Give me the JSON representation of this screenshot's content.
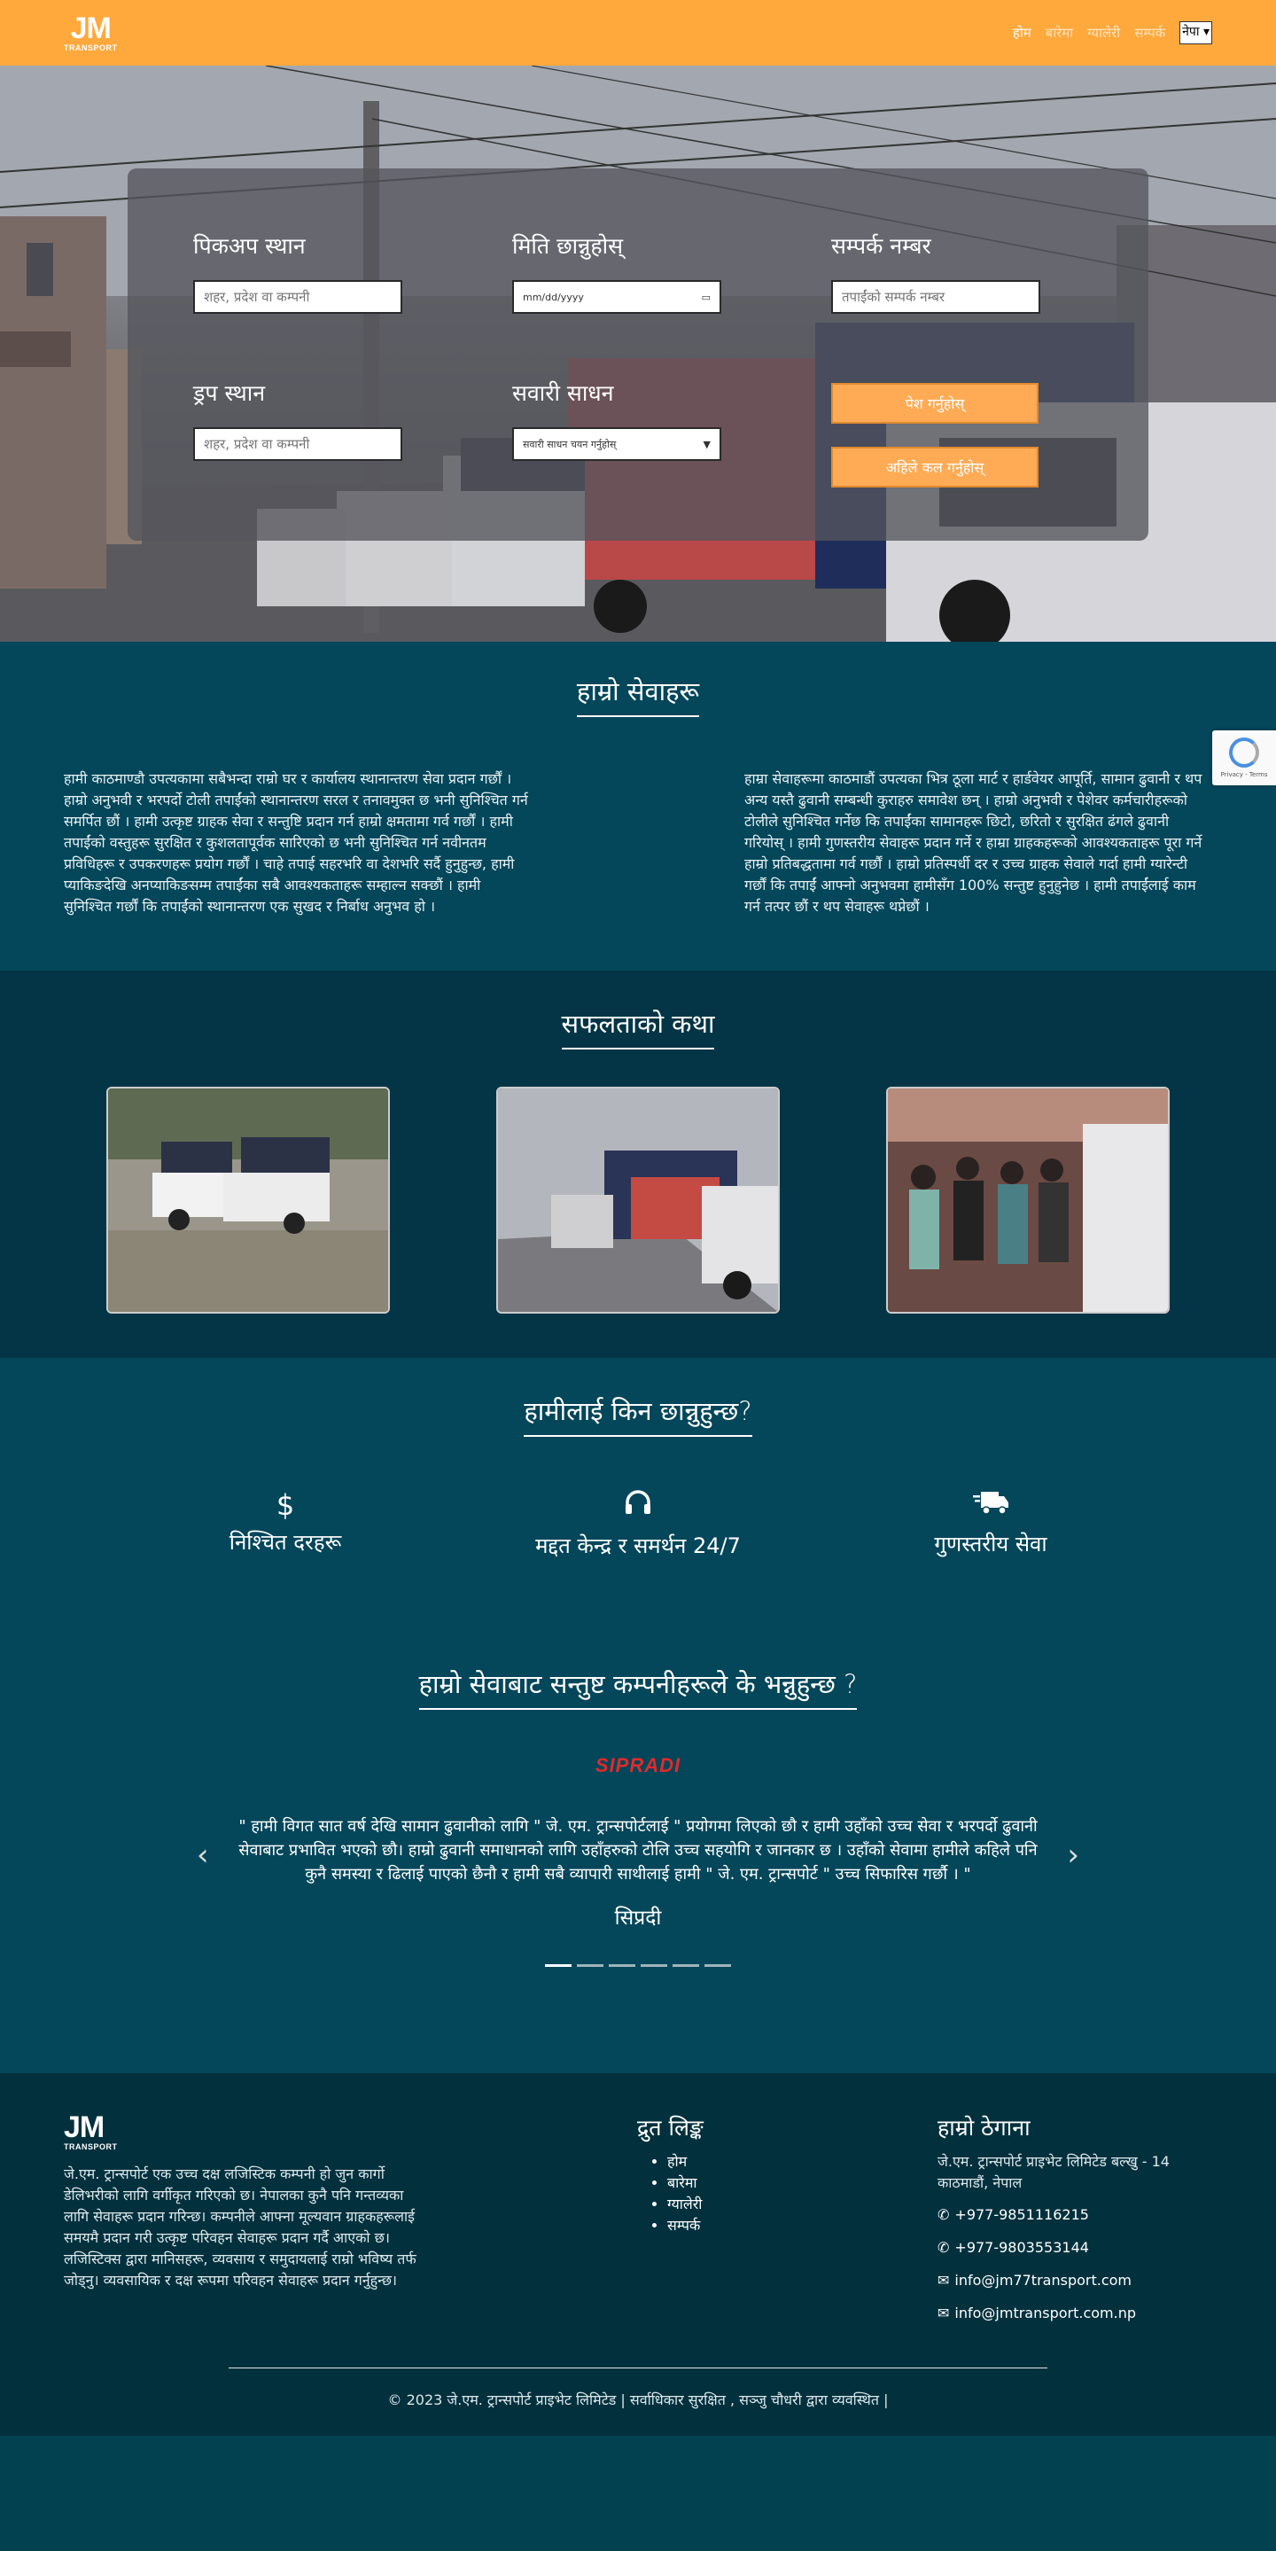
{
  "header": {
    "logo_mark": "JM",
    "logo_sub": "TRANSPORT",
    "nav": [
      "होम",
      "बारेमा",
      "ग्यालेरी",
      "सम्पर्क"
    ],
    "language": "नेपा"
  },
  "booking": {
    "pickup_label": "पिकअप स्थान",
    "pickup_placeholder": "शहर, प्रदेश वा कम्पनी",
    "date_label": "मिति छान्नुहोस्",
    "date_placeholder": "mm/dd/yyyy",
    "contact_label": "सम्पर्क नम्बर",
    "contact_placeholder": "तपाईंको सम्पर्क नम्बर",
    "drop_label": "ड्रप स्थान",
    "drop_placeholder": "शहर, प्रदेश वा कम्पनी",
    "vehicle_label": "सवारी साधन",
    "vehicle_value": "सवारी साधन चयन गर्नुहोस्",
    "submit_label": "पेश गर्नुहोस्",
    "call_label": "अहिले कल गर्नुहोस्"
  },
  "services": {
    "title": "हाम्रो सेवाहरू",
    "col1": "हामी काठमाण्डौ उपत्यकामा सबैभन्दा राम्रो घर र कार्यालय स्थानान्तरण सेवा प्रदान गर्छौं । हाम्रो अनुभवी र भरपर्दो टोली तपाईंको स्थानान्तरण सरल र तनावमुक्त छ भनी सुनिश्चित गर्न समर्पित छौं । हामी उत्कृष्ट ग्राहक सेवा र सन्तुष्टि प्रदान गर्न हाम्रो क्षमतामा गर्व गर्छौं । हामी तपाईंको वस्तुहरू सुरक्षित र कुशलतापूर्वक सारिएको छ भनी सुनिश्चित गर्न नवीनतम प्रविधिहरू र उपकरणहरू प्रयोग गर्छौं । चाहे तपाई सहरभरि वा देशभरि सर्दै हुनुहुन्छ, हामी प्याकिङदेखि अनप्याकिङसम्म तपाईंका सबै आवश्यकताहरू सम्हाल्न सक्छौं । हामी सुनिश्चित गर्छौं कि तपाईंको स्थानान्तरण एक सुखद र निर्बाध अनुभव हो ।",
    "col2": "हाम्रा सेवाहरूमा काठमाडौं उपत्यका भित्र ठूला मार्ट र हार्डवेयर आपूर्ति, सामान ढुवानी र थप अन्य यस्तै ढुवानी सम्बन्धी कुराहरु समावेश छन् । हाम्रो अनुभवी र पेशेवर कर्मचारीहरूको टोलीले सुनिश्चित गर्नेछ कि तपाईंका सामानहरू छिटो, छरितो र सुरक्षित ढंगले ढुवानी गरियोस् । हामी गुणस्तरीय सेवाहरू प्रदान गर्ने र हाम्रा ग्राहकहरूको आवश्यकताहरू पूरा गर्ने हाम्रो प्रतिबद्धतामा गर्व गर्छौं । हाम्रो प्रतिस्पर्धी दर र उच्च ग्राहक सेवाले गर्दा हामी ग्यारेन्टी गर्छौं कि तपाईं आफ्नो अनुभवमा हामीसँग 100% सन्तुष्ट हुनुहुनेछ । हामी तपाईंलाई काम गर्न तत्पर छौं र थप सेवाहरू थप्नेछौं ।"
  },
  "stories": {
    "title": "सफलताको कथा"
  },
  "why": {
    "title": "हामीलाई किन छान्नुहुन्छ?",
    "features": [
      {
        "icon": "dollar-icon",
        "label": "निश्चित दरहरू"
      },
      {
        "icon": "headset-icon",
        "label": "मद्दत केन्द्र र समर्थन 24/7"
      },
      {
        "icon": "truck-fast-icon",
        "label": "गुणस्तरीय सेवा"
      }
    ]
  },
  "testimonials": {
    "title": "हाम्रो सेवाबाट सन्तुष्ट कम्पनीहरूले के भन्नुहुन्छ ?",
    "brand": "SIPRADI",
    "quote": "\" हामी विगत सात वर्ष देखि सामान ढुवानीको लागि \" जे. एम. ट्रान्सपोर्टलाई \" प्रयोगमा लिएको छौ र हामी उहाँको उच्च सेवा र भरपर्दो ढुवानी सेवाबाट प्रभावित भएको छौ। हाम्रो ढुवानी समाधानको लागि उहाँहरुको टोलि उच्च सहयोगि र जानकार छ । उहाँको सेवामा हामीले कहिले पनि कुनै समस्या र ढिलाई पाएको छैनौ र हामी सबै व्यापारी साथीलाई हामी \" जे. एम. ट्रान्सपोर्ट \" उच्च सिफारिस गर्छौ । \"",
    "author": "सिप्रदी",
    "slides": 6,
    "active_slide": 1
  },
  "footer": {
    "about": "जे.एम. ट्रान्सपोर्ट एक उच्च दक्ष लजिस्टिक कम्पनी हो जुन कार्गो डेलिभरीको लागि वर्गीकृत गरिएको छ। नेपालका कुनै पनि गन्तव्यका लागि सेवाहरू प्रदान गरिन्छ। कम्पनीले आफ्ना मूल्यवान ग्राहकहरूलाई समयमै प्रदान गरी उत्कृष्ट परिवहन सेवाहरू प्रदान गर्दै आएको छ। लजिस्टिक्स द्वारा मानिसहरू, व्यवसाय र समुदायलाई राम्रो भविष्य तर्फ जोड्नु। व्यवसायिक र दक्ष रूपमा परिवहन सेवाहरू प्रदान गर्नुहुन्छ।",
    "links_title": "द्रुत लिङ्क",
    "links": [
      "होम",
      "बारेमा",
      "ग्यालेरी",
      "सम्पर्क"
    ],
    "address_title": "हाम्रो ठेगाना",
    "address": "जे.एम. ट्रान्सपोर्ट प्राइभेट लिमिटेड बल्खु - 14 काठमाडौं, नेपाल",
    "phones": [
      "+977-9851116215",
      "+977-9803553144"
    ],
    "emails": [
      "info@jm77transport.com",
      "info@jmtransport.com.np"
    ],
    "copyright": "© 2023 जे.एम. ट्रान्सपोर्ट प्राइभेट लिमिटेड | सर्वाधिकार सुरक्षित , सञ्जु चौधरी द्वारा व्यवस्थित |"
  }
}
